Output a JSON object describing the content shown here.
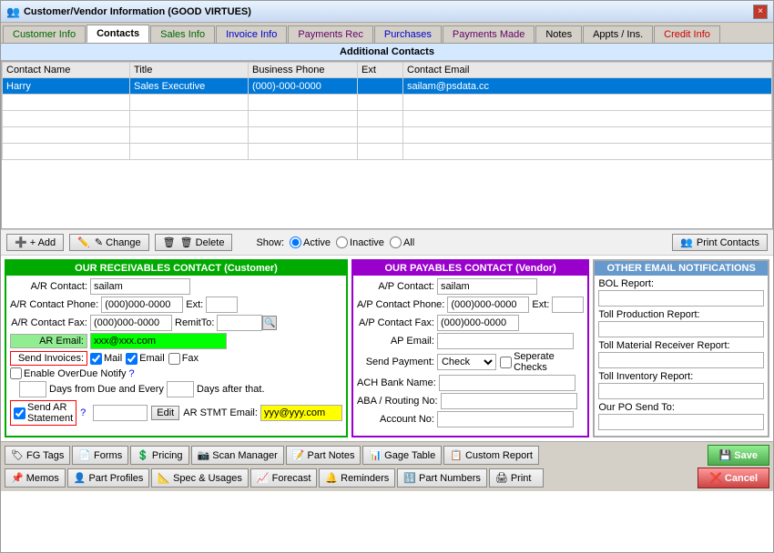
{
  "window": {
    "title": "Customer/Vendor Information  (GOOD VIRTUES)",
    "close_label": "×"
  },
  "tabs": [
    {
      "id": "customer-info",
      "label": "Customer Info",
      "color": "green-text",
      "active": false
    },
    {
      "id": "contacts",
      "label": "Contacts",
      "color": "",
      "active": true
    },
    {
      "id": "sales-info",
      "label": "Sales Info",
      "color": "green-text",
      "active": false
    },
    {
      "id": "invoice-info",
      "label": "Invoice Info",
      "color": "blue-text",
      "active": false
    },
    {
      "id": "payments-rec",
      "label": "Payments Rec",
      "color": "purple-text",
      "active": false
    },
    {
      "id": "purchases",
      "label": "Purchases",
      "color": "blue-text",
      "active": false
    },
    {
      "id": "payments-made",
      "label": "Payments Made",
      "color": "purple-text",
      "active": false
    },
    {
      "id": "notes",
      "label": "Notes",
      "color": "",
      "active": false
    },
    {
      "id": "appts-ins",
      "label": "Appts / Ins.",
      "color": "",
      "active": false
    },
    {
      "id": "credit-info",
      "label": "Credit Info",
      "color": "red-text",
      "active": false
    }
  ],
  "section_header": "Additional Contacts",
  "table": {
    "headers": [
      "Contact Name",
      "Title",
      "Business Phone",
      "Ext",
      "Contact Email"
    ],
    "rows": [
      {
        "name": "Harry",
        "title": "Sales Executive",
        "phone": "(000)-000-0000",
        "ext": "",
        "email": "sailam@psdata.cc",
        "selected": true
      }
    ]
  },
  "toolbar": {
    "add_label": "+ Add",
    "change_label": "✎ Change",
    "delete_label": "🗑 Delete",
    "show_label": "Show:",
    "active_label": "Active",
    "inactive_label": "Inactive",
    "all_label": "All",
    "print_label": "Print Contacts"
  },
  "ar_panel": {
    "header": "OUR RECEIVABLES CONTACT (Customer)",
    "ar_contact_label": "A/R Contact:",
    "ar_contact_value": "sailam",
    "ar_phone_label": "A/R Contact Phone:",
    "ar_phone_value": "(000)000-0000",
    "ext_label": "Ext:",
    "ext_value": "",
    "ar_fax_label": "A/R Contact Fax:",
    "ar_fax_value": "(000)000-0000",
    "remit_label": "RemitTo:",
    "ar_email_label": "AR Email:",
    "ar_email_value": "xxx@xxx.com",
    "send_invoices_label": "Send Invoices:",
    "mail_label": "Mail",
    "email_label": "Email",
    "fax_label": "Fax",
    "mail_checked": true,
    "email_checked": true,
    "fax_checked": false,
    "overdue_label": "Enable OverDue Notify",
    "days_from_label": "Days from Due and Every",
    "days_after_label": "Days after that.",
    "send_ar_label": "Send AR Statement",
    "question_mark": "?",
    "edit_label": "Edit",
    "ar_stmt_email_label": "AR STMT Email:",
    "ar_stmt_email_value": "yyy@yyy.com"
  },
  "ap_panel": {
    "header": "OUR PAYABLES CONTACT (Vendor)",
    "ap_contact_label": "A/P Contact:",
    "ap_contact_value": "sailam",
    "ap_phone_label": "A/P Contact Phone:",
    "ap_phone_value": "(000)000-0000",
    "ext_label": "Ext:",
    "ext_value": "",
    "ap_fax_label": "A/P Contact Fax:",
    "ap_fax_value": "(000)000-0000",
    "ap_email_label": "AP Email:",
    "ap_email_value": "",
    "send_payment_label": "Send Payment:",
    "send_payment_value": "Check",
    "separate_checks_label": "Seperate Checks",
    "ach_bank_label": "ACH Bank Name:",
    "ach_bank_value": "",
    "aba_routing_label": "ABA / Routing No:",
    "aba_routing_value": "",
    "account_no_label": "Account No:",
    "account_no_value": ""
  },
  "other_panel": {
    "header": "OTHER EMAIL NOTIFICATIONS",
    "bol_label": "BOL Report:",
    "bol_value": "",
    "toll_prod_label": "Toll Production Report:",
    "toll_prod_value": "",
    "toll_mat_label": "Toll Material Receiver Report:",
    "toll_mat_value": "",
    "toll_inv_label": "Toll Inventory Report:",
    "toll_inv_value": "",
    "our_po_label": "Our PO Send To:",
    "our_po_value": ""
  },
  "bottom_bar": {
    "row1": [
      {
        "id": "fg-tags",
        "icon": "🏷",
        "label": "FG Tags"
      },
      {
        "id": "forms",
        "icon": "📄",
        "label": "Forms"
      },
      {
        "id": "pricing",
        "icon": "$",
        "label": "Pricing"
      },
      {
        "id": "scan-manager",
        "icon": "📷",
        "label": "Scan Manager"
      },
      {
        "id": "part-notes",
        "icon": "📝",
        "label": "Part Notes"
      },
      {
        "id": "gage-table",
        "icon": "📊",
        "label": "Gage Table"
      },
      {
        "id": "custom-report",
        "icon": "📋",
        "label": "Custom Report"
      }
    ],
    "row2": [
      {
        "id": "memos",
        "icon": "📌",
        "label": "Memos"
      },
      {
        "id": "part-profiles",
        "icon": "👤",
        "label": "Part Profiles"
      },
      {
        "id": "spec-usages",
        "icon": "📐",
        "label": "Spec & Usages"
      },
      {
        "id": "forecast",
        "icon": "📈",
        "label": "Forecast"
      },
      {
        "id": "reminders",
        "icon": "🔔",
        "label": "Reminders"
      },
      {
        "id": "part-numbers",
        "icon": "🔢",
        "label": "Part Numbers"
      },
      {
        "id": "print",
        "icon": "🖨",
        "label": "Print"
      }
    ],
    "save_label": "Save",
    "cancel_label": "Cancel"
  }
}
